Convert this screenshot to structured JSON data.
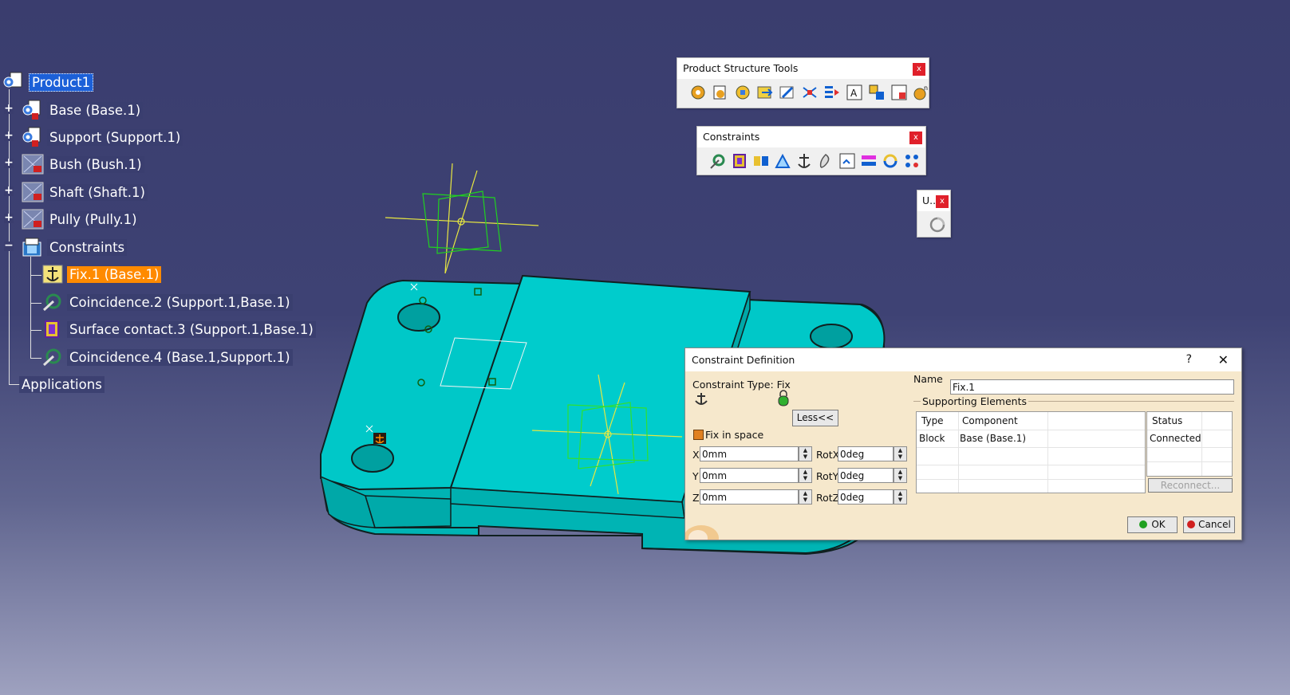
{
  "colors": {
    "background_top": "#3a3d6e",
    "part_color": "#00c8c8",
    "tree_selection": "#1c60d8",
    "tree_highlight": "#ff8a00"
  },
  "tree": {
    "root": "Product1",
    "items": [
      {
        "label": "Base (Base.1)",
        "icon": "product-icon"
      },
      {
        "label": "Support (Support.1)",
        "icon": "product-icon"
      },
      {
        "label": "Bush (Bush.1)",
        "icon": "part-icon"
      },
      {
        "label": "Shaft (Shaft.1)",
        "icon": "part-icon"
      },
      {
        "label": "Pully (Pully.1)",
        "icon": "part-icon"
      },
      {
        "label": "Constraints",
        "icon": "constraints-folder-icon"
      }
    ],
    "constraints": [
      {
        "label": "Fix.1 (Base.1)",
        "icon": "fix-constraint-icon"
      },
      {
        "label": "Coincidence.2 (Support.1,Base.1)",
        "icon": "coincidence-icon"
      },
      {
        "label": "Surface contact.3 (Support.1,Base.1)",
        "icon": "surface-contact-icon"
      },
      {
        "label": "Coincidence.4 (Base.1,Support.1)",
        "icon": "coincidence-icon"
      }
    ],
    "applications": "Applications"
  },
  "toolbars": {
    "product_structure": {
      "title": "Product Structure Tools",
      "close": "x"
    },
    "constraints": {
      "title": "Constraints",
      "close": "x"
    },
    "update": {
      "title": "U..",
      "close": "x"
    }
  },
  "dialog": {
    "title": "Constraint Definition",
    "help": "?",
    "close": "✕",
    "constraint_type_label": "Constraint Type: Fix",
    "less_button": "Less<<",
    "fix_in_space": "Fix in space",
    "fix_in_space_checked": true,
    "x_label": "X",
    "x_value": "0mm",
    "y_label": "Y",
    "y_value": "0mm",
    "z_label": "Z",
    "z_value": "0mm",
    "rotx_label": "RotX",
    "rotx_value": "0deg",
    "roty_label": "RotY",
    "roty_value": "0deg",
    "rotz_label": "RotZ",
    "rotz_value": "0deg",
    "name_label": "Name",
    "name_value": "Fix.1",
    "supporting_elements": "Supporting Elements",
    "table_headers": {
      "type": "Type",
      "component": "Component",
      "status": "Status"
    },
    "rows": [
      {
        "type": "Block",
        "component": "Base (Base.1)",
        "status": "Connected"
      }
    ],
    "reconnect_button": "Reconnect...",
    "ok_button": "OK",
    "cancel_button": "Cancel"
  }
}
